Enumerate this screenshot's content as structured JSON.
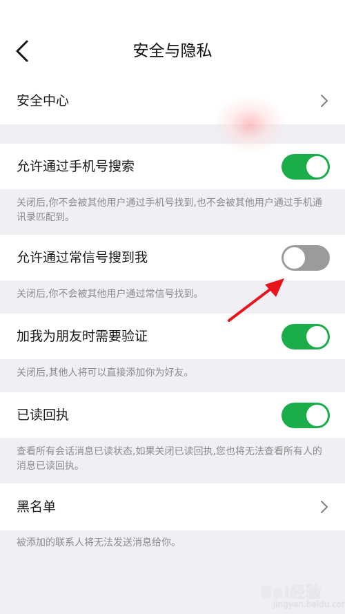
{
  "header": {
    "title": "安全与隐私"
  },
  "sections": {
    "security_center": {
      "label": "安全中心"
    },
    "phone_search": {
      "label": "允许通过手机号搜索",
      "enabled": true,
      "desc": "关闭后,你不会被其他用户通过手机号找到,也不会被其他用户通过手机通讯录匹配到。"
    },
    "id_search": {
      "label": "允许通过常信号搜到我",
      "enabled": false,
      "desc": "关闭后,你不会被其他用户通过常信号找到。"
    },
    "friend_verify": {
      "label": "加我为朋友时需要验证",
      "enabled": true,
      "desc": "关闭后,其他人将可以直接添加你为好友。"
    },
    "read_receipt": {
      "label": "已读回执",
      "enabled": true,
      "desc": "查看所有会话消息已读状态,如果关闭已读回执,您也将无法查看所有人的消息已读回执。"
    },
    "blacklist": {
      "label": "黑名单",
      "desc": "被添加的联系人将无法发送消息给你。"
    }
  },
  "watermark": {
    "text": "Bai经验",
    "sub": "jingyan.baidu.com"
  },
  "colors": {
    "toggle_on": "#1aad4a",
    "toggle_off": "#9b9b9b",
    "arrow": "#e8141c",
    "background": "#efeff4"
  }
}
